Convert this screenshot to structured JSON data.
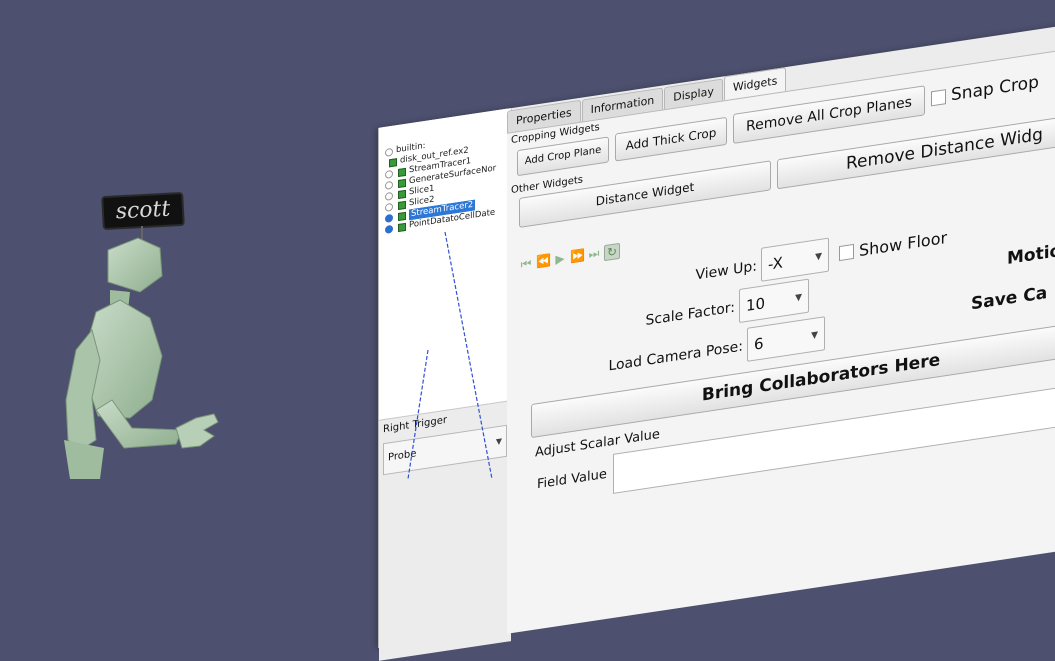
{
  "avatar": {
    "nametag": "scott"
  },
  "pipeline": {
    "items": [
      {
        "label": "builtin:",
        "icon": "server-icon",
        "visible": false,
        "selected": false,
        "indent": 0
      },
      {
        "label": "disk_out_ref.ex2",
        "icon": "cube-icon",
        "visible": false,
        "selected": false,
        "indent": 1
      },
      {
        "label": "StreamTracer1",
        "icon": "cube-icon",
        "visible": false,
        "selected": false,
        "indent": 2
      },
      {
        "label": "GenerateSurfaceNor",
        "icon": "cube-icon",
        "visible": false,
        "selected": false,
        "indent": 2
      },
      {
        "label": "Slice1",
        "icon": "cube-icon",
        "visible": false,
        "selected": false,
        "indent": 2
      },
      {
        "label": "Slice2",
        "icon": "cube-icon",
        "visible": false,
        "selected": false,
        "indent": 2
      },
      {
        "label": "StreamTracer2",
        "icon": "cube-icon",
        "visible": true,
        "selected": true,
        "indent": 2
      },
      {
        "label": "PointDatatoCellDatе",
        "icon": "cube-icon",
        "visible": true,
        "selected": false,
        "indent": 2
      }
    ]
  },
  "trigger": {
    "label": "Right Trigger",
    "value": "Probe"
  },
  "tabs": [
    {
      "label": "Properties",
      "active": false
    },
    {
      "label": "Information",
      "active": false
    },
    {
      "label": "Display",
      "active": false
    },
    {
      "label": "Widgets",
      "active": true
    }
  ],
  "cropping": {
    "title": "Cropping Widgets",
    "add_crop_plane": "Add Crop Plane",
    "add_thick_crop": "Add Thick Crop",
    "remove_all": "Remove All Crop Planes",
    "snap_crop": "Snap Crop"
  },
  "other": {
    "title": "Other Widgets",
    "distance_widget": "Distance Widget",
    "remove_distance": "Remove Distance Widg"
  },
  "media_controls": [
    "first-frame-icon",
    "previous-frame-icon",
    "play-icon",
    "next-frame-icon",
    "last-frame-icon",
    "loop-icon"
  ],
  "view": {
    "view_up_label": "View Up:",
    "view_up_value": "-X",
    "show_floor": "Show Floor",
    "scale_factor_label": "Scale Factor:",
    "scale_factor_value": "10",
    "motion_label": "Motio",
    "load_pose_label": "Load Camera Pose:",
    "load_pose_value": "6",
    "save_label": "Save Ca",
    "bring_collaborators": "Bring Collaborators Here"
  },
  "scalar": {
    "title": "Adjust Scalar Value",
    "field_value_label": "Field Value"
  },
  "colors": {
    "background": "#4d506e",
    "avatar": "#a8c4a8",
    "selection": "#2d77d6",
    "probe_ray": "#3050d8"
  }
}
